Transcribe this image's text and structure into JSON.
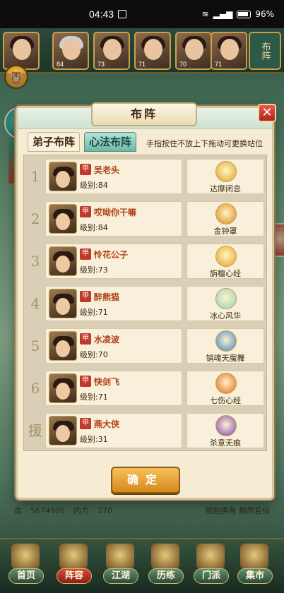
{
  "status_bar": {
    "time": "04:43",
    "battery": "96%"
  },
  "top_bar": {
    "hero_levels": [
      "",
      "84",
      "73",
      "71",
      "70",
      "71"
    ],
    "formation_label": "布阵"
  },
  "dialog": {
    "title": "布阵",
    "close_label": "✕",
    "tabs": [
      "弟子布阵",
      "心法布阵"
    ],
    "hint": "手指按住不放上下拖动可更换站位",
    "level_prefix": "级别:",
    "grade": "甲",
    "rows": [
      {
        "num": "1",
        "name": "吴老头",
        "level": "84",
        "skill": "达摩闭息",
        "skill_color": "#e0a31c"
      },
      {
        "num": "2",
        "name": "哎呦你干嘛",
        "level": "84",
        "skill": "金钟罩",
        "skill_color": "#d98a14"
      },
      {
        "num": "3",
        "name": "怜花公子",
        "level": "73",
        "skill": "旃檀心经",
        "skill_color": "#e6a21a"
      },
      {
        "num": "4",
        "name": "醉熊猫",
        "level": "71",
        "skill": "冰心风华",
        "skill_color": "#8fd0c0"
      },
      {
        "num": "5",
        "name": "水凌波",
        "level": "70",
        "skill": "销魂天魔舞",
        "skill_color": "#3a7fc8"
      },
      {
        "num": "6",
        "name": "快剑飞",
        "level": "71",
        "skill": "七伤心经",
        "skill_color": "#e0671a"
      },
      {
        "num": "援",
        "name": "燕大侠",
        "level": "31",
        "skill": "杀意无痕",
        "skill_color": "#7b3fb6"
      }
    ],
    "confirm_label": "确定"
  },
  "background_stats": {
    "hp_label": "血",
    "hp_value": "5674906",
    "power_label": "内力",
    "power_value": "270",
    "right_text": "脱胎换骨  飘然若仙"
  },
  "bottom_nav": [
    "首页",
    "阵容",
    "江湖",
    "历练",
    "门派",
    "集市"
  ]
}
